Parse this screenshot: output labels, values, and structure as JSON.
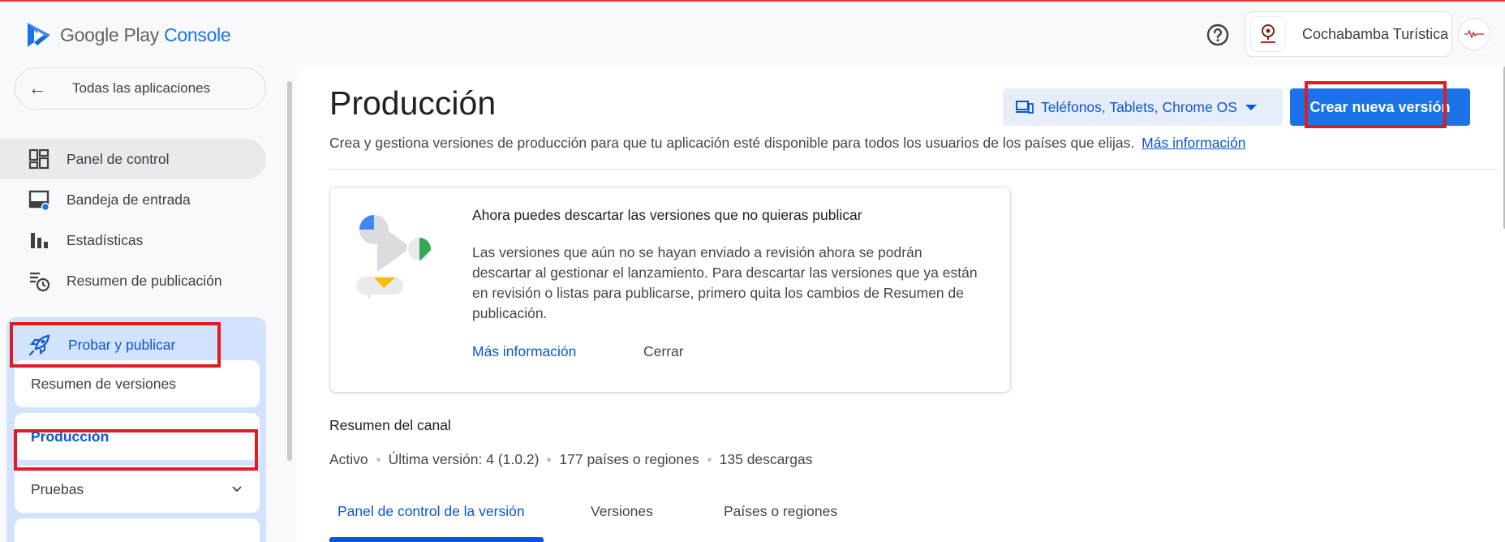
{
  "app": {
    "logo_google_play": "Google Play ",
    "logo_console": "Console",
    "account_name": "Cochabamba Turística"
  },
  "sidebar": {
    "back_label": "Todas las aplicaciones",
    "items": [
      {
        "label": "Panel de control",
        "icon": "dashboard-icon"
      },
      {
        "label": "Bandeja de entrada",
        "icon": "inbox-icon"
      },
      {
        "label": "Estadísticas",
        "icon": "bar-chart-icon"
      },
      {
        "label": "Resumen de publicación",
        "icon": "publishing-overview-icon"
      }
    ],
    "group": {
      "label": "Probar y publicar",
      "icon": "rocket-icon",
      "subitems": [
        {
          "label": "Resumen de versiones"
        },
        {
          "label": "Producción"
        },
        {
          "label": "Pruebas"
        }
      ]
    }
  },
  "main": {
    "title": "Producción",
    "device_selector": "Teléfonos, Tablets, Chrome OS",
    "create_button": "Crear nueva versión",
    "subtitle": "Crea y gestiona versiones de producción para que tu aplicación esté disponible para todos los usuarios de los países que elijas.",
    "subtitle_link": "Más información",
    "info_card": {
      "title": "Ahora puedes descartar las versiones que no quieras publicar",
      "body": "Las versiones que aún no se hayan enviado a revisión ahora se podrán descartar al gestionar el lanzamiento. Para descartar las versiones que ya están en revisión o listas para publicarse, primero quita los cambios de Resumen de publicación.",
      "link": "Más información",
      "close": "Cerrar"
    },
    "channel": {
      "title": "Resumen del canal",
      "status": "Activo",
      "latest": "Última versión: 4 (1.0.2)",
      "countries": "177 países o regiones",
      "downloads": "135 descargas"
    },
    "tabs": [
      {
        "label": "Panel de control de la versión"
      },
      {
        "label": "Versiones"
      },
      {
        "label": "Países o regiones"
      }
    ]
  },
  "colors": {
    "accent": "#0b57d0",
    "primary_button": "#1a73e8",
    "highlight_box": "#e01b22"
  }
}
